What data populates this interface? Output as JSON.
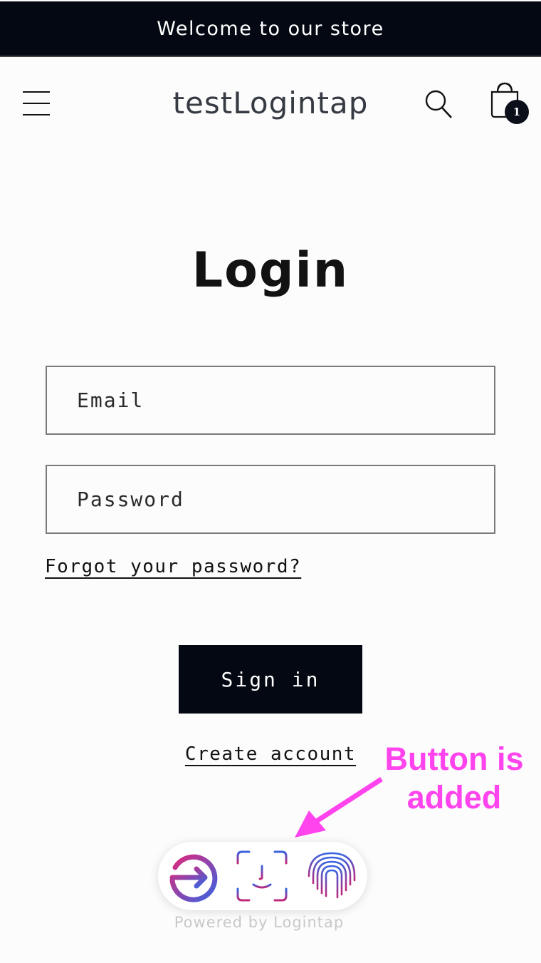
{
  "announcement": {
    "text": "Welcome to our store"
  },
  "header": {
    "logo": "testLogintap",
    "menu_icon": "hamburger-menu-icon",
    "search_icon": "search-icon",
    "cart_icon": "shopping-bag-icon",
    "cart_count": "1"
  },
  "login": {
    "title": "Login",
    "email_placeholder": "Email",
    "email_value": "",
    "password_placeholder": "Password",
    "password_value": "",
    "forgot_link": "Forgot your password?",
    "signin_label": "Sign in",
    "create_account_link": "Create account"
  },
  "annotation": {
    "line1": "Button is",
    "line2": "added",
    "color": "#ff44ee"
  },
  "logintap_widget": {
    "buttons": [
      {
        "icon": "login-arrow-icon"
      },
      {
        "icon": "face-id-icon"
      },
      {
        "icon": "fingerprint-icon"
      }
    ],
    "powered_by": "Powered by Logintap",
    "gradient_start": "#e0287a",
    "gradient_end": "#3a63e0"
  }
}
